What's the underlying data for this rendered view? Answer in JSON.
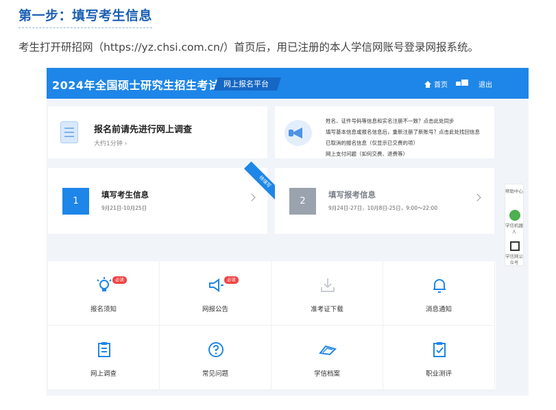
{
  "step_title": "第一步：填写考生信息",
  "intro": "考生打开研招网（https://yz.chsi.com.cn/）首页后，用已注册的本人学信网账号登录网报系统。",
  "topbar": {
    "brand": "2024年全国硕士研究生招生考试",
    "badge": "网上报名平台",
    "home": "首页",
    "logout": "退出"
  },
  "survey": {
    "title": "报名前请先进行网上调查",
    "sub": "大约1分钟 ›"
  },
  "notice": {
    "lines": [
      "姓名、证件号码等信息和实名注册不一致？点击此处同步",
      "填写基本信息或报名信息后，重新注册了新账号？点击此处找回信息",
      "已取消的报名信息（仅显示已交费的项）",
      "网上支付问题（如何交费、退费等）"
    ]
  },
  "tasks": [
    {
      "num": "1",
      "title": "填写考生信息",
      "date": "9月21日-10月25日",
      "ribbon": "待填写"
    },
    {
      "num": "2",
      "title": "填写报考信息",
      "date": "9月24日-27日，10月8日-25日，9:00～22:00"
    }
  ],
  "tiles": [
    {
      "label": "报名须知",
      "icon": "lightbulb-icon",
      "tag": "必读"
    },
    {
      "label": "网报公告",
      "icon": "megaphone-icon",
      "tag": "必读"
    },
    {
      "label": "准考证下载",
      "icon": "download-icon"
    },
    {
      "label": "消息通知",
      "icon": "bell-icon"
    },
    {
      "label": "网上调查",
      "icon": "clipboard-icon"
    },
    {
      "label": "常见问题",
      "icon": "question-icon"
    },
    {
      "label": "学信档案",
      "icon": "archive-icon"
    },
    {
      "label": "职业测评",
      "icon": "checklist-icon"
    }
  ],
  "side": {
    "help": "帮助中心",
    "bot": "学信机器人",
    "qr": "学信网公众号"
  },
  "colors": {
    "brand_blue": "#1e86e8",
    "title_blue": "#1a5fb4",
    "muted_gray": "#9aa3ad",
    "tag_red": "#ef4444"
  }
}
